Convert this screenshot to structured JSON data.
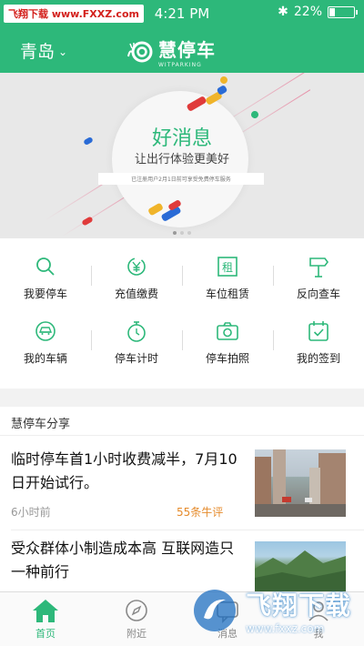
{
  "status_bar": {
    "site_watermark": "飞翔下载 www.FXXZ.com",
    "time": "4:21 PM",
    "battery": "22%",
    "battery_level": 0.22
  },
  "header": {
    "city": "青岛",
    "logo_cn": "慧停车",
    "logo_en": "WITPARKING"
  },
  "banner": {
    "title": "好消息",
    "subtitle": "让出行体验更美好",
    "note": "已注册用户2月1日前可享受免费停车服务"
  },
  "services": [
    {
      "label": "我要停车",
      "icon": "search-icon"
    },
    {
      "label": "充值缴费",
      "icon": "yen-icon"
    },
    {
      "label": "车位租赁",
      "icon": "rent-icon"
    },
    {
      "label": "反向查车",
      "icon": "signpost-icon"
    },
    {
      "label": "我的车辆",
      "icon": "car-icon"
    },
    {
      "label": "停车计时",
      "icon": "stopwatch-icon"
    },
    {
      "label": "停车拍照",
      "icon": "camera-icon"
    },
    {
      "label": "我的签到",
      "icon": "calendar-check-icon"
    }
  ],
  "news": {
    "section_title": "慧停车分享",
    "items": [
      {
        "title": "临时停车首1小时收费减半，7月10日开始试行。",
        "time": "6小时前",
        "comments": "55条牛评"
      },
      {
        "title": "受众群体小制造成本高 互联网造只一种前行",
        "time": "",
        "comments": ""
      }
    ]
  },
  "tabs": [
    {
      "label": "首页",
      "icon": "home-icon",
      "active": true
    },
    {
      "label": "附近",
      "icon": "compass-icon",
      "active": false
    },
    {
      "label": "消息",
      "icon": "message-icon",
      "active": false
    },
    {
      "label": "我",
      "icon": "user-icon",
      "active": false
    }
  ],
  "watermark": {
    "cn": "飞翔下载",
    "url": "www.fxxz.com"
  },
  "colors": {
    "brand": "#2db87a",
    "accent_orange": "#e58b2c"
  }
}
